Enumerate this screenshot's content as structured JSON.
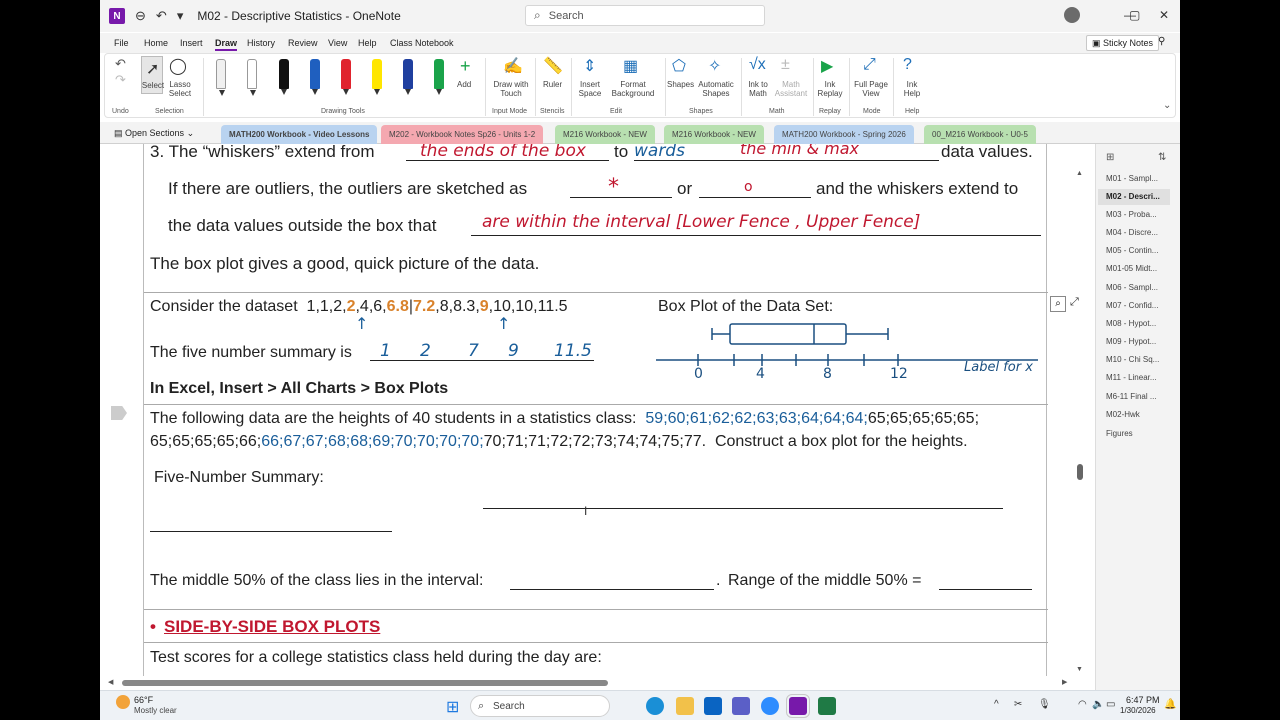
{
  "window": {
    "app_icon": "N",
    "title": "M02 - Descriptive Statistics  -  OneNote",
    "search_placeholder": "Search",
    "minimize": "—",
    "maximize": "▢",
    "close": "✕"
  },
  "menu": {
    "items": [
      "File",
      "Home",
      "Insert",
      "Draw",
      "History",
      "Review",
      "View",
      "Help",
      "Class Notebook"
    ],
    "active": "Draw",
    "sticky_notes": "Sticky Notes"
  },
  "ribbon": {
    "undo_label": "Undo",
    "select_label": "Select",
    "lasso_label": "Lasso Select",
    "selection_group": "Selection",
    "drawing_tools_group": "Drawing Tools",
    "add_label": "Add",
    "draw_touch_label": "Draw with Touch",
    "input_mode_group": "Input Mode",
    "ruler_label": "Ruler",
    "stencils_group": "Stencils",
    "insert_space_label": "Insert Space",
    "format_bg_label": "Format Background",
    "edit_group": "Edit",
    "shapes_label": "Shapes",
    "auto_shapes_label": "Automatic Shapes",
    "shapes_group": "Shapes",
    "ink_math_label": "Ink to Math",
    "math_assistant_label": "Math Assistant",
    "math_group": "Math",
    "ink_replay_label": "Ink Replay",
    "replay_group": "Replay",
    "full_page_label": "Full Page View",
    "mode_group": "Mode",
    "ink_help_label": "Ink Help",
    "help_group": "Help",
    "pen_colors": [
      "#ffffff",
      "#ffffff",
      "#111111",
      "#1f5fbf",
      "#e0242e",
      "#ffe600",
      "#1f3f9f",
      "#1aa34a"
    ]
  },
  "sections": {
    "open_sections": "Open Sections",
    "tabs": [
      {
        "label": "MATH200 Workbook - Video Lessons",
        "color": "#b9d3f0"
      },
      {
        "label": "M202 - Workbook Notes Sp26 - Units 1-2",
        "color": "#f4a8b0"
      },
      {
        "label": "M216 Workbook - NEW",
        "color": "#b8e0b0"
      },
      {
        "label": "M216 Workbook - NEW",
        "color": "#b8e0b0"
      },
      {
        "label": "MATH200 Workbook - Spring 2026",
        "color": "#b9d3f0"
      },
      {
        "label": "00_M216 Workbook - U0-5",
        "color": "#b8e0b0"
      }
    ]
  },
  "content": {
    "whiskers_line": "3. The “whiskers” extend from",
    "whiskers_hand1": "the ends of the box",
    "whiskers_to": "to",
    "whiskers_hand2": "wards",
    "whiskers_hand3": "the min & max",
    "whiskers_end": "data values.",
    "outliers_line": "If there are outliers, the outliers are sketched as",
    "outlier_star": "*",
    "outliers_or": "or",
    "outlier_dot": "o",
    "outliers_end": "and the whiskers extend to",
    "interval_line": "the data values outside the box that",
    "interval_hand": "are within the interval  [Lower Fence , Upper Fence]",
    "boxplot_summary": "The box plot gives a good, quick picture of the data.",
    "dataset_label": "Consider the dataset",
    "dataset_pre": "1,1,2,",
    "dataset_q1": "2",
    "dataset_mid1": ",4,6,",
    "dataset_m1": "6.8",
    "dataset_m2": "7.2",
    "dataset_mid2": ",8,8.3,",
    "dataset_q3": "9",
    "dataset_post": ",10,10,11.5",
    "boxplot_title": "Box Plot of the Data Set:",
    "five_number_label": "The five number summary is",
    "five_number_values": [
      "1",
      "2",
      "7",
      "9",
      "11.5"
    ],
    "excel_hint": "In Excel, Insert > All Charts > Box Plots",
    "axis_ticks": [
      "0",
      "4",
      "8",
      "12"
    ],
    "axis_label": "Label for x",
    "heights_intro": "The following data are the heights of 40 students in a statistics class:",
    "heights_blue1": "59;60;61;62;62;63;63;64;64;64;",
    "heights_black1": "65;65;65;65;65;",
    "heights_black2": "65;65;65;65;66;",
    "heights_blue2": "66;67;67;68;68;69;70;70;70;70;",
    "heights_black3": "70;71;71;72;72;73;74;74;75;77.",
    "heights_task": "Construct a box plot for the heights.",
    "five_number_summary": "Five-Number Summary:",
    "middle50": "The middle 50% of the class lies in the interval:",
    "range_middle": "Range of the middle 50% =",
    "bullet": "•",
    "side_by_side": "SIDE-BY-SIDE BOX PLOTS",
    "test_scores": "Test scores for a college statistics class held during the day are:"
  },
  "pages": {
    "items": [
      "M01 - Sampl...",
      "M02 - Descri...",
      "M03 - Proba...",
      "M04 - Discre...",
      "M05 - Contin...",
      "M01-05 Midt...",
      "M06 - Sampl...",
      "M07 - Confid...",
      "M08 - Hypot...",
      "M09 - Hypot...",
      "M10 - Chi Sq...",
      "M11 - Linear...",
      "M6-11 Final ...",
      "M02-Hwk",
      "Figures"
    ],
    "selected_index": 1
  },
  "taskbar": {
    "weather_temp": "66°F",
    "weather_desc": "Mostly clear",
    "search": "Search",
    "time": "6:47 PM",
    "date": "1/30/2026"
  }
}
